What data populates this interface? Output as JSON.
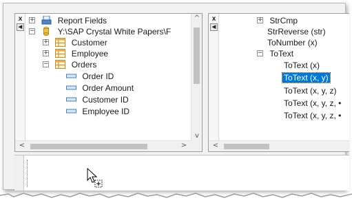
{
  "left_pane": {
    "tool_close": "x",
    "items": [
      {
        "label": "Report Fields",
        "expander": "+",
        "icon": "report-fields-icon"
      },
      {
        "label": "Y:\\SAP Crystal White Papers\\F",
        "expander": "−",
        "icon": "database-icon"
      },
      {
        "label": "Customer",
        "expander": "+",
        "icon": "table-icon"
      },
      {
        "label": "Employee",
        "expander": "+",
        "icon": "table-icon"
      },
      {
        "label": "Orders",
        "expander": "−",
        "icon": "table-icon"
      },
      {
        "label": "Order ID",
        "icon": "field-icon"
      },
      {
        "label": "Order Amount",
        "icon": "field-icon"
      },
      {
        "label": "Customer ID",
        "icon": "field-icon"
      },
      {
        "label": "Employee ID",
        "icon": "field-icon"
      }
    ]
  },
  "right_pane": {
    "tool_close": "x",
    "items": [
      {
        "label": "StrCmp",
        "expander": "+"
      },
      {
        "label": "StrReverse (str)"
      },
      {
        "label": "ToNumber (x)"
      },
      {
        "label": "ToText",
        "expander": "−"
      },
      {
        "label": "ToText (x)"
      },
      {
        "label": "ToText (x, y)",
        "selected": true
      },
      {
        "label": "ToText (x, y, z)"
      },
      {
        "label": "ToText (x, y, z, •"
      },
      {
        "label": "ToText (x, y, z, •"
      }
    ]
  },
  "colors": {
    "selection": "#0078d7",
    "frame": "#f2f2f2"
  },
  "icons": {
    "drag_cursor": "arrow-with-plus-cursor-icon"
  }
}
